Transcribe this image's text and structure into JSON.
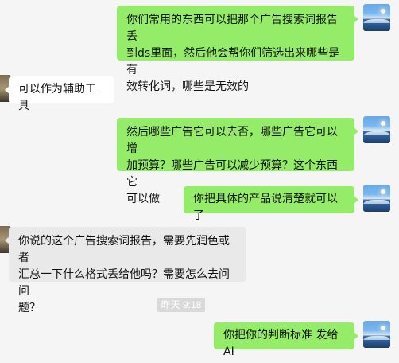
{
  "messages": [
    {
      "side": "right",
      "text": "你们常用的东西可以把那个广告搜索词报告丢\n到ds里面，然后他会帮你们筛选出来哪些是有\n效转化词，哪些是无效的"
    },
    {
      "side": "left",
      "text": "可以作为辅助工具"
    },
    {
      "side": "right",
      "text": "然后哪些广告它可以去否，哪些广告它可以增\n加预算？哪些广告可以减少预算？这个东西它\n可以做"
    },
    {
      "side": "right",
      "text": "你把具体的产品说清楚就可以了"
    },
    {
      "side": "left",
      "text": "你说的这个广告搜索词报告，需要先润色或者\n汇总一下什么格式丢给他吗？需要怎么去问问\n题？"
    },
    {
      "side": "right",
      "text": "你把你的判断标准 发给AI"
    }
  ],
  "timestamp": "昨天 9:18",
  "icons": {
    "self_avatar": "avatar-icon",
    "other_avatar": "avatar-icon"
  }
}
